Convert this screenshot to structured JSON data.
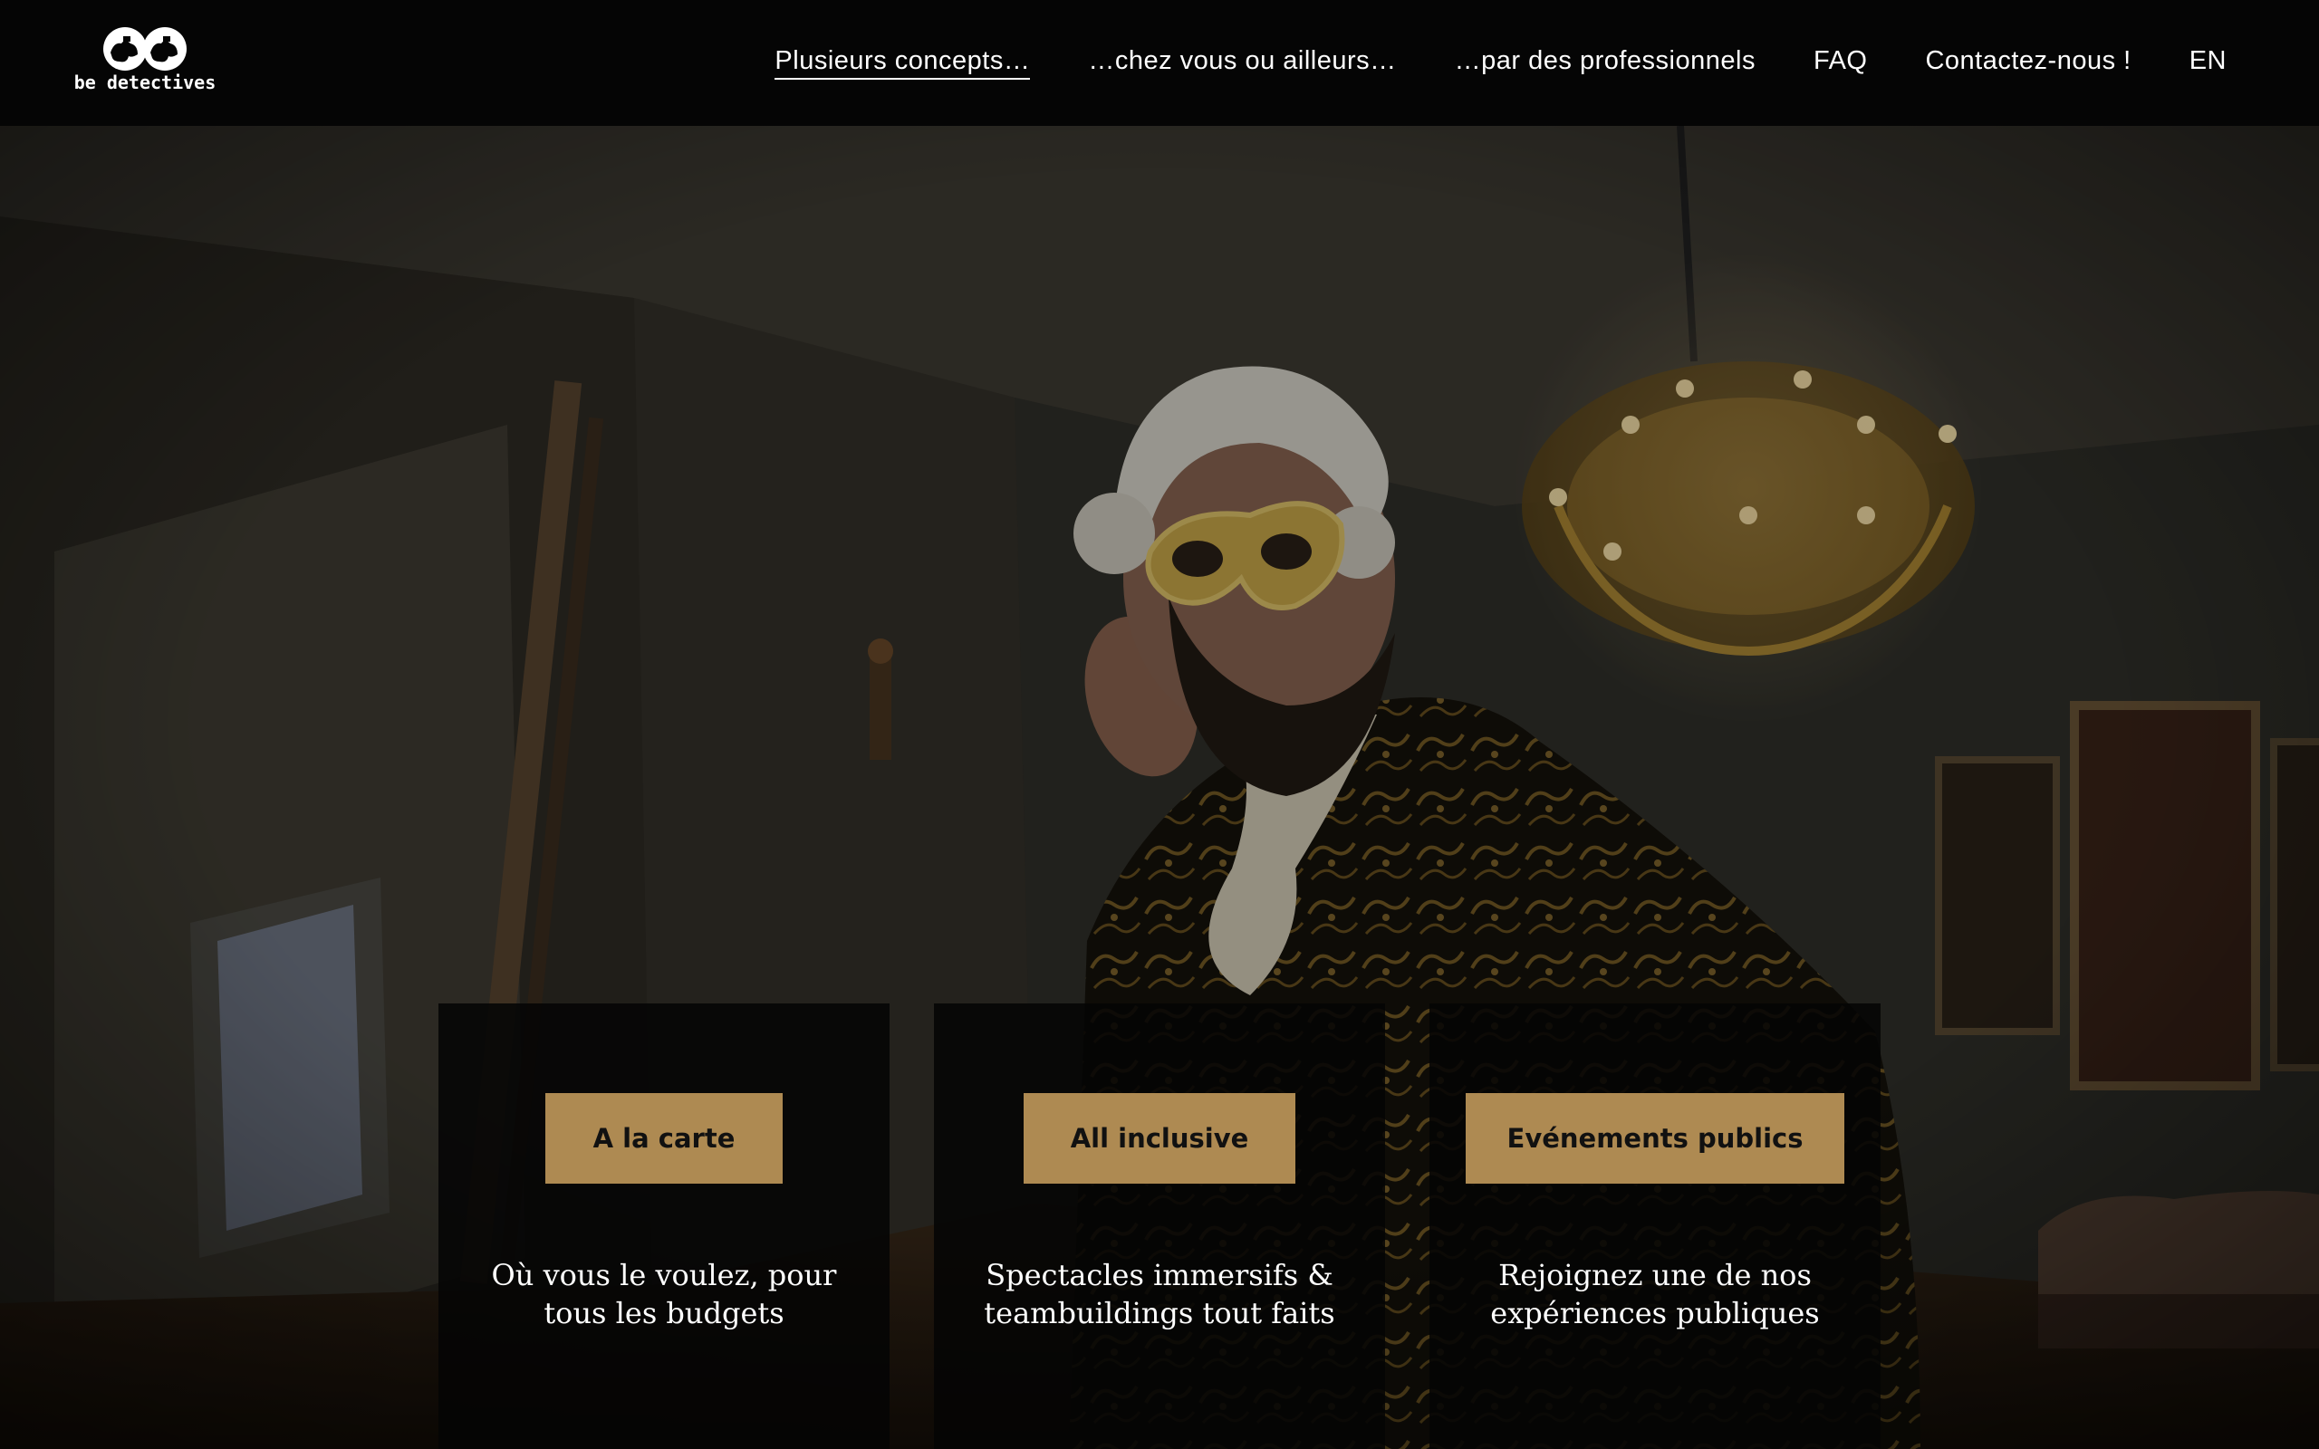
{
  "brand": {
    "name": "be detectives",
    "logo_icon": "two-detective-heads-logo"
  },
  "nav": {
    "items": [
      {
        "label": "Plusieurs concepts…",
        "active": true
      },
      {
        "label": "…chez vous ou ailleurs…",
        "active": false
      },
      {
        "label": "…par des professionnels",
        "active": false
      },
      {
        "label": "FAQ",
        "active": false
      },
      {
        "label": "Contactez-nous !",
        "active": false
      },
      {
        "label": "EN",
        "active": false
      }
    ]
  },
  "hero": {
    "image": "masked-character-in-baroque-ballroom"
  },
  "cards": [
    {
      "button": "A la carte",
      "description": "Où vous le voulez, pour tous les budgets"
    },
    {
      "button": "All inclusive",
      "description": "Spectacles immersifs & teambuildings tout faits"
    },
    {
      "button": "Evénements publics",
      "description": "Rejoignez une de nos expériences publiques"
    }
  ],
  "colors": {
    "header_bg": "#050505",
    "button_gold": "#ae8a52",
    "card_bg": "#050505",
    "text": "#ffffff"
  }
}
